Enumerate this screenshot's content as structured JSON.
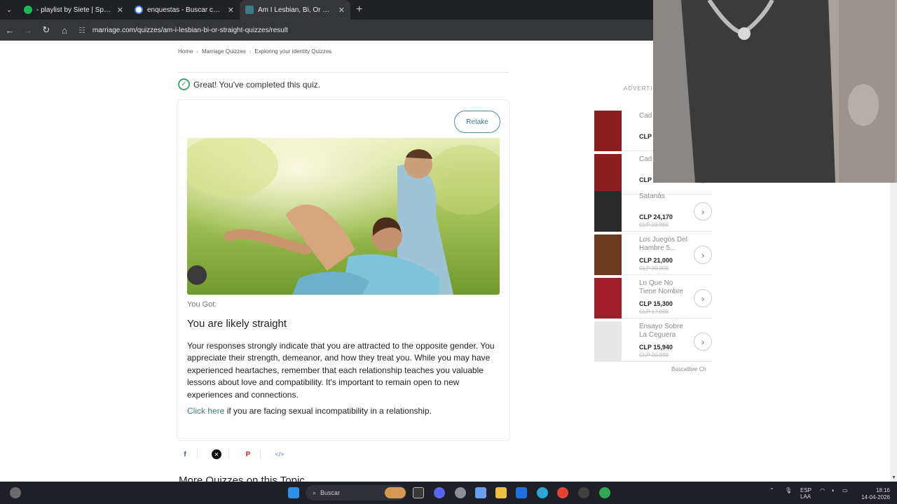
{
  "browser": {
    "tabs": [
      {
        "label": "- playlist by Siete | Spotify",
        "active": false,
        "color": "#1db954"
      },
      {
        "label": "enquestas - Buscar con Google",
        "active": false,
        "color": "#ffffff"
      },
      {
        "label": "Am I Lesbian, Bi, Or Straight Qu",
        "active": true,
        "color": "#3d7c85"
      }
    ],
    "url": "marriage.com/quizzes/am-i-lesbian-bi-or-straight-quizzes/result"
  },
  "breadcrumb": [
    "Home",
    "Marriage Quizzes",
    "Exploring your identity Quizzes"
  ],
  "completed_text": "Great! You've completed this quiz.",
  "retake_label": "Retake",
  "result": {
    "you_got_label": "You Got:",
    "title": "You are likely straight",
    "description": "Your responses strongly indicate that you are attracted to the opposite gender. You appreciate their strength, demeanor, and how they treat you. While you may have experienced heartaches, remember that each relationship teaches you valuable lessons about love and compatibility. It's important to remain open to new experiences and connections.",
    "link_text": "Click here",
    "link_suffix": " if you are facing sexual incompatibility in a relationship."
  },
  "share_icons": [
    "facebook-icon",
    "x-icon",
    "pinterest-icon",
    "embed-icon"
  ],
  "more_quizzes_heading": "More Quizzes on this Topic",
  "ad": {
    "label": "ADVERTIS",
    "items": [
      {
        "name": "Cad Exqu",
        "price": "CLP",
        "old": "",
        "cover": "#8b1e1e"
      },
      {
        "name": "Cad Exqu",
        "price": "CLP",
        "old": "",
        "cover": "#8b1e1e"
      },
      {
        "name": "Satanás",
        "price": "CLP 24,170",
        "old": "CLP 23.950",
        "cover": "#2a2a2a"
      },
      {
        "name": "Los Juegos Del Hambre 5...",
        "price": "CLP 21,000",
        "old": "CLP 30.000",
        "cover": "#6b3a1f"
      },
      {
        "name": "Lo Que No Tiene Nombre",
        "price": "CLP 15,300",
        "old": "CLP 17.000",
        "cover": "#a01c28"
      },
      {
        "name": "Ensayo Sobre La Ceguera",
        "price": "CLP 15,940",
        "old": "CLP 20.990",
        "cover": "#e8e8e8"
      }
    ],
    "source": "Buscalibre Ch"
  },
  "taskbar": {
    "search_placeholder": "Buscar",
    "lang_top": "ESP",
    "lang_bottom": "LAA",
    "time": "18:16",
    "date": "14-04-2026"
  }
}
